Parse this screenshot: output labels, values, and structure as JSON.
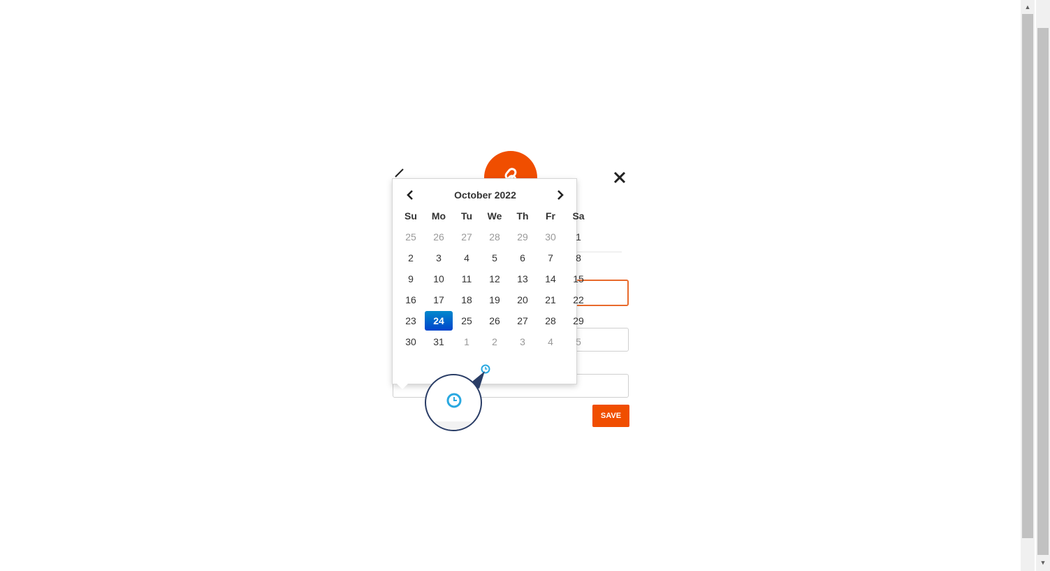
{
  "dialog": {
    "save_label": "SAVE",
    "logo_icon": "link-icon",
    "close_icon": "close-icon",
    "colors": {
      "brand": "#f04e00",
      "active_border": "#e86a2c"
    }
  },
  "datepicker": {
    "month_title": "October 2022",
    "prev_icon": "chevron-left-icon",
    "next_icon": "chevron-right-icon",
    "weekdays": [
      "Su",
      "Mo",
      "Tu",
      "We",
      "Th",
      "Fr",
      "Sa"
    ],
    "weeks": [
      [
        {
          "d": "25",
          "m": "old"
        },
        {
          "d": "26",
          "m": "old"
        },
        {
          "d": "27",
          "m": "old"
        },
        {
          "d": "28",
          "m": "old"
        },
        {
          "d": "29",
          "m": "old"
        },
        {
          "d": "30",
          "m": "old"
        },
        {
          "d": "1",
          "m": "cur"
        }
      ],
      [
        {
          "d": "2",
          "m": "cur"
        },
        {
          "d": "3",
          "m": "cur"
        },
        {
          "d": "4",
          "m": "cur"
        },
        {
          "d": "5",
          "m": "cur"
        },
        {
          "d": "6",
          "m": "cur"
        },
        {
          "d": "7",
          "m": "cur"
        },
        {
          "d": "8",
          "m": "cur"
        }
      ],
      [
        {
          "d": "9",
          "m": "cur"
        },
        {
          "d": "10",
          "m": "cur"
        },
        {
          "d": "11",
          "m": "cur"
        },
        {
          "d": "12",
          "m": "cur"
        },
        {
          "d": "13",
          "m": "cur"
        },
        {
          "d": "14",
          "m": "cur"
        },
        {
          "d": "15",
          "m": "cur"
        }
      ],
      [
        {
          "d": "16",
          "m": "cur"
        },
        {
          "d": "17",
          "m": "cur"
        },
        {
          "d": "18",
          "m": "cur"
        },
        {
          "d": "19",
          "m": "cur"
        },
        {
          "d": "20",
          "m": "cur"
        },
        {
          "d": "21",
          "m": "cur"
        },
        {
          "d": "22",
          "m": "cur"
        }
      ],
      [
        {
          "d": "23",
          "m": "cur"
        },
        {
          "d": "24",
          "m": "active"
        },
        {
          "d": "25",
          "m": "cur"
        },
        {
          "d": "26",
          "m": "cur"
        },
        {
          "d": "27",
          "m": "cur"
        },
        {
          "d": "28",
          "m": "cur"
        },
        {
          "d": "29",
          "m": "cur"
        }
      ],
      [
        {
          "d": "30",
          "m": "cur"
        },
        {
          "d": "31",
          "m": "cur"
        },
        {
          "d": "1",
          "m": "new"
        },
        {
          "d": "2",
          "m": "new"
        },
        {
          "d": "3",
          "m": "new"
        },
        {
          "d": "4",
          "m": "new"
        },
        {
          "d": "5",
          "m": "new"
        }
      ]
    ],
    "selected_day": "24",
    "time_toggle_icon": "clock-icon",
    "colors": {
      "selected_start": "#0088cc",
      "selected_end": "#0044cc",
      "time_icon": "#29a8e0"
    }
  }
}
